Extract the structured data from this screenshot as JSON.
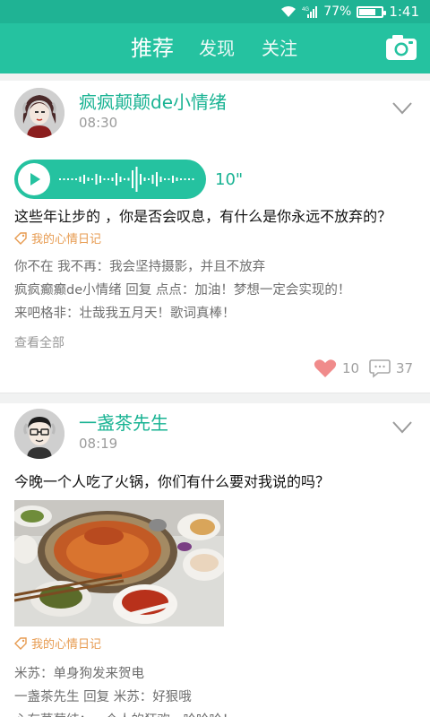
{
  "status": {
    "battery_text": "77%",
    "time": "1:41",
    "battery_level": 0.77
  },
  "nav": {
    "tabs": [
      "推荐",
      "发现",
      "关注"
    ]
  },
  "posts": [
    {
      "username": "疯疯颠颠de小情绪",
      "time": "08:30",
      "voice_duration": "10\"",
      "content": "这些年让步的 ，你是否会叹息，有什么是你永远不放弃的？",
      "tag": "我的心情日记",
      "comments": [
        "你不在  我不再：我会坚持摄影，并且不放弃",
        "疯疯癫癫de小情绪  回复  点点：加油！梦想一定会实现的！",
        "来吧格非：壮哉我五月天！歌词真棒！"
      ],
      "view_all": "查看全部",
      "likes": "10",
      "comment_count": "37"
    },
    {
      "username": "一盏茶先生",
      "time": "08:19",
      "content": "今晚一个人吃了火锅，你们有什么要对我说的吗？",
      "tag": "我的心情日记",
      "comments": [
        "米苏：单身狗发来贺电",
        "一盏茶先生  回复  米苏：好狠哦",
        "心有草莓结：一个人的狂欢，哈哈哈！"
      ]
    }
  ]
}
